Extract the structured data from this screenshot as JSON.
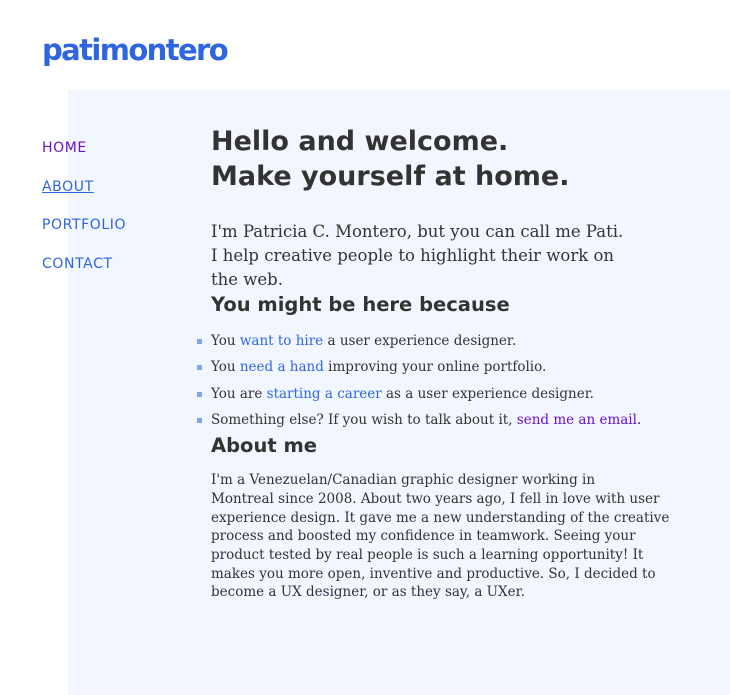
{
  "site": {
    "logo_text": "patimontero"
  },
  "nav": {
    "items": [
      {
        "label": "HOME"
      },
      {
        "label": "ABOUT"
      },
      {
        "label": "PORTFOLIO"
      },
      {
        "label": "CONTACT"
      }
    ]
  },
  "hero": {
    "title_line1": "Hello and welcome.",
    "title_line2": "Make yourself at home.",
    "intro_lines": [
      "I'm Patricia C. Montero, but you can call me Pati.",
      "I help creative people to highlight their work on",
      "the web."
    ]
  },
  "reasons": {
    "title": "You might be here because",
    "items": [
      {
        "before": "You ",
        "link": "want to hire",
        "after": " a user experience designer."
      },
      {
        "before": "You ",
        "link": "need a hand",
        "after": " improving your online portfolio."
      },
      {
        "before": "You are ",
        "link": "starting a career",
        "after": " as a user experience designer."
      },
      {
        "before": "Something else? If you wish to talk about it, ",
        "link": "send me an email",
        "after": "."
      }
    ]
  },
  "about": {
    "title": "About me",
    "lines": [
      "I'm a Venezuelan/Canadian graphic designer working in",
      "Montreal since 2008. About two years ago, I fell in love with user",
      "experience design. It gave me a new understanding of the creative",
      "process and boosted my confidence in teamwork. Seeing your",
      "product tested by real people is such a learning opportunity! It",
      "makes you more open, inventive and productive. So, I decided to",
      "become a UX designer, or as they say, a UXer."
    ]
  },
  "colors": {
    "link": "#2f66e0",
    "visited_link": "#6a12c9",
    "panel_background": "#f2f6fe",
    "text": "#333333",
    "bullet": "#7fa8ea"
  }
}
